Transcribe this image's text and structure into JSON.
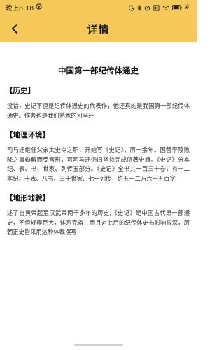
{
  "status_bar": {
    "time": "晚上8:18",
    "battery": "#"
  },
  "nav": {
    "title": "详情"
  },
  "article": {
    "title": "中国第一部纪传体通史",
    "sections": [
      {
        "heading": "【历史】",
        "body": "没错，史记不但是纪传体通史的代表作，他还真的是我国第一部纪传体通史。作者也是我们熟悉的司马迁"
      },
      {
        "heading": "【地理环境】",
        "body": "司马迁继任父亲太史令之职，开始写《史记》，历十余年。因替李陵败降之事辩解而受宫刑，可司马迁仍旧坚持完成所著史籍。《史记》分本纪、表、书、世家、列传五部分。《史记》全书共一百三十卷，有十二本纪、十表、八书、三十世家、七十列传，约五十二万六千五百字"
      },
      {
        "heading": "【地形地貌】",
        "body": "述了自黄帝起至汉武帝两千多年的历史,《史记》是中国古代第一部通史，不但规模巨大，体系完备，而且对此后的纪传体史书影响很深，历朝正史皆采用这种体裁撰写"
      }
    ]
  }
}
